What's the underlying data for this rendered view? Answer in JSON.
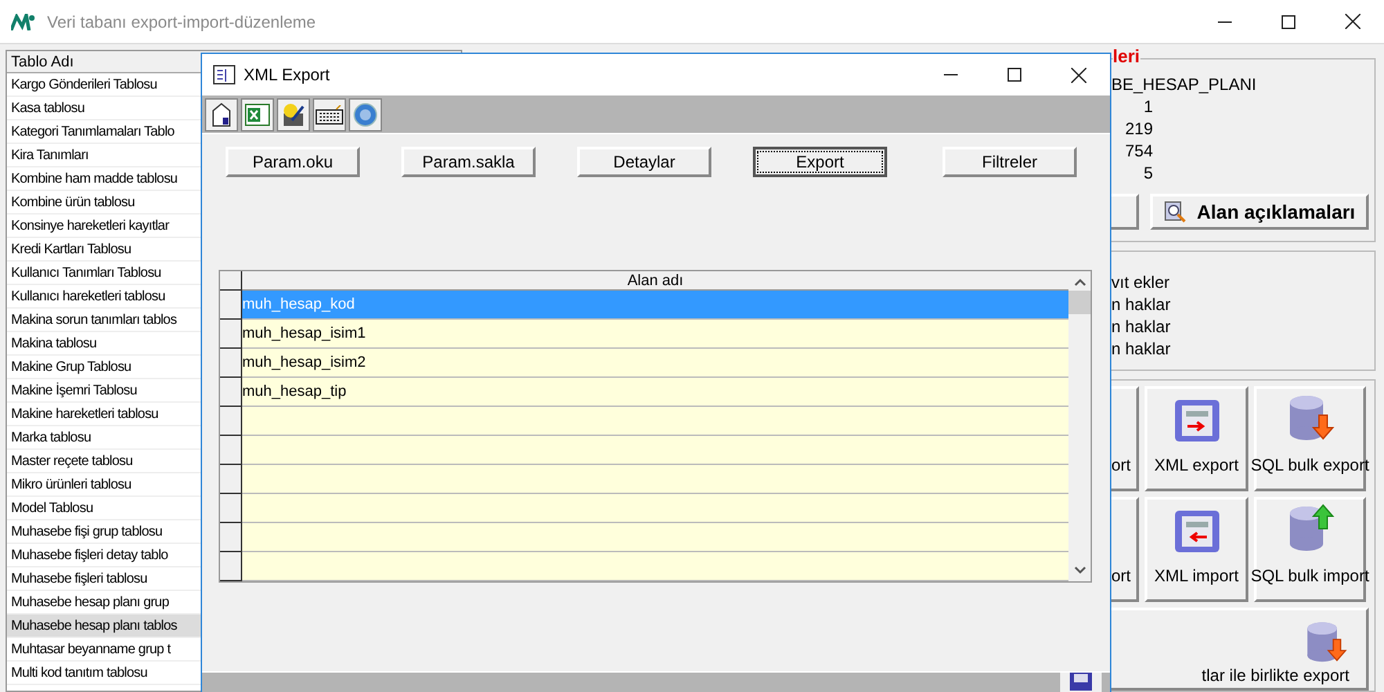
{
  "main_window": {
    "title": "Veri tabanı export-import-düzenleme",
    "table": {
      "header": "Tablo Adı",
      "rows": [
        {
          "text": "Kargo Gönderileri Tablosu",
          "selected": false
        },
        {
          "text": "Kasa tablosu",
          "selected": false
        },
        {
          "text": "Kategori Tanımlamaları Tablo",
          "selected": false
        },
        {
          "text": "Kira Tanımları",
          "selected": false
        },
        {
          "text": "Kombine ham madde tablosu",
          "selected": false
        },
        {
          "text": "Kombine ürün tablosu",
          "selected": false
        },
        {
          "text": "Konsinye hareketleri kayıtlar",
          "selected": false
        },
        {
          "text": "Kredi Kartları Tablosu",
          "selected": false
        },
        {
          "text": "Kullanıcı Tanımları Tablosu",
          "selected": false
        },
        {
          "text": "Kullanıcı hareketleri tablosu",
          "selected": false
        },
        {
          "text": "Makina sorun tanımları tablos",
          "selected": false
        },
        {
          "text": "Makina tablosu",
          "selected": false
        },
        {
          "text": "Makine Grup Tablosu",
          "selected": false
        },
        {
          "text": "Makine İşemri Tablosu",
          "selected": false
        },
        {
          "text": "Makine hareketleri tablosu",
          "selected": false
        },
        {
          "text": "Marka tablosu",
          "selected": false
        },
        {
          "text": "Master reçete tablosu",
          "selected": false
        },
        {
          "text": "Mikro ürünleri tablosu",
          "selected": false
        },
        {
          "text": "Model Tablosu",
          "selected": false
        },
        {
          "text": "Muhasebe fişi grup tablosu",
          "selected": false
        },
        {
          "text": "Muhasebe fişleri detay tablo",
          "selected": false
        },
        {
          "text": "Muhasebe fişleri tablosu",
          "selected": false
        },
        {
          "text": "Muhasebe hesap planı grup",
          "selected": false
        },
        {
          "text": "Muhasebe hesap planı tablos",
          "selected": true
        },
        {
          "text": "Muhtasar beyanname grup t",
          "selected": false
        },
        {
          "text": "Multi kod tanıtım tablosu",
          "selected": false
        }
      ]
    },
    "properties": {
      "title": "leri",
      "name": "BE_HESAP_PLANI",
      "values": [
        "1",
        "219",
        "754",
        "5"
      ]
    },
    "field_button": {
      "label": "Alan açıklamaları"
    },
    "permissions": [
      "vıt ekler",
      "n haklar",
      "n haklar",
      "n haklar"
    ],
    "tiles": [
      {
        "kind": "partial",
        "label": "ort"
      },
      {
        "kind": "xml_export",
        "label": "XML export"
      },
      {
        "kind": "sql_export",
        "label": "SQL bulk export"
      },
      {
        "kind": "partial",
        "label": "ort"
      },
      {
        "kind": "xml_import",
        "label": "XML import"
      },
      {
        "kind": "sql_import",
        "label": "SQL bulk import"
      }
    ],
    "wide_tile": {
      "label": "tlar ile birlikte export"
    }
  },
  "dialog": {
    "title": "XML Export",
    "buttons": [
      {
        "label": "Param.oku",
        "focused": false
      },
      {
        "label": "Param.sakla",
        "focused": false
      },
      {
        "label": "Detaylar",
        "focused": false
      },
      {
        "label": "Export",
        "focused": true
      },
      {
        "label": "Filtreler",
        "focused": false
      }
    ],
    "grid": {
      "column": "Alan adı",
      "rows": [
        {
          "text": "muh_hesap_kod",
          "selected": true
        },
        {
          "text": "muh_hesap_isim1",
          "selected": false
        },
        {
          "text": "muh_hesap_isim2",
          "selected": false
        },
        {
          "text": "muh_hesap_tip",
          "selected": false
        }
      ]
    }
  }
}
